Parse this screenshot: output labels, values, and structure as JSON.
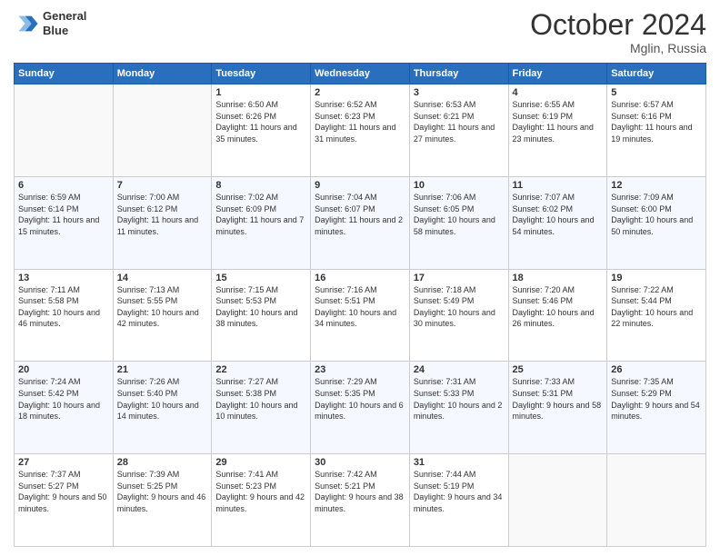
{
  "header": {
    "logo_line1": "General",
    "logo_line2": "Blue",
    "month": "October 2024",
    "location": "Mglin, Russia"
  },
  "days_of_week": [
    "Sunday",
    "Monday",
    "Tuesday",
    "Wednesday",
    "Thursday",
    "Friday",
    "Saturday"
  ],
  "weeks": [
    [
      {
        "day": "",
        "info": ""
      },
      {
        "day": "",
        "info": ""
      },
      {
        "day": "1",
        "sunrise": "Sunrise: 6:50 AM",
        "sunset": "Sunset: 6:26 PM",
        "daylight": "Daylight: 11 hours and 35 minutes."
      },
      {
        "day": "2",
        "sunrise": "Sunrise: 6:52 AM",
        "sunset": "Sunset: 6:23 PM",
        "daylight": "Daylight: 11 hours and 31 minutes."
      },
      {
        "day": "3",
        "sunrise": "Sunrise: 6:53 AM",
        "sunset": "Sunset: 6:21 PM",
        "daylight": "Daylight: 11 hours and 27 minutes."
      },
      {
        "day": "4",
        "sunrise": "Sunrise: 6:55 AM",
        "sunset": "Sunset: 6:19 PM",
        "daylight": "Daylight: 11 hours and 23 minutes."
      },
      {
        "day": "5",
        "sunrise": "Sunrise: 6:57 AM",
        "sunset": "Sunset: 6:16 PM",
        "daylight": "Daylight: 11 hours and 19 minutes."
      }
    ],
    [
      {
        "day": "6",
        "sunrise": "Sunrise: 6:59 AM",
        "sunset": "Sunset: 6:14 PM",
        "daylight": "Daylight: 11 hours and 15 minutes."
      },
      {
        "day": "7",
        "sunrise": "Sunrise: 7:00 AM",
        "sunset": "Sunset: 6:12 PM",
        "daylight": "Daylight: 11 hours and 11 minutes."
      },
      {
        "day": "8",
        "sunrise": "Sunrise: 7:02 AM",
        "sunset": "Sunset: 6:09 PM",
        "daylight": "Daylight: 11 hours and 7 minutes."
      },
      {
        "day": "9",
        "sunrise": "Sunrise: 7:04 AM",
        "sunset": "Sunset: 6:07 PM",
        "daylight": "Daylight: 11 hours and 2 minutes."
      },
      {
        "day": "10",
        "sunrise": "Sunrise: 7:06 AM",
        "sunset": "Sunset: 6:05 PM",
        "daylight": "Daylight: 10 hours and 58 minutes."
      },
      {
        "day": "11",
        "sunrise": "Sunrise: 7:07 AM",
        "sunset": "Sunset: 6:02 PM",
        "daylight": "Daylight: 10 hours and 54 minutes."
      },
      {
        "day": "12",
        "sunrise": "Sunrise: 7:09 AM",
        "sunset": "Sunset: 6:00 PM",
        "daylight": "Daylight: 10 hours and 50 minutes."
      }
    ],
    [
      {
        "day": "13",
        "sunrise": "Sunrise: 7:11 AM",
        "sunset": "Sunset: 5:58 PM",
        "daylight": "Daylight: 10 hours and 46 minutes."
      },
      {
        "day": "14",
        "sunrise": "Sunrise: 7:13 AM",
        "sunset": "Sunset: 5:55 PM",
        "daylight": "Daylight: 10 hours and 42 minutes."
      },
      {
        "day": "15",
        "sunrise": "Sunrise: 7:15 AM",
        "sunset": "Sunset: 5:53 PM",
        "daylight": "Daylight: 10 hours and 38 minutes."
      },
      {
        "day": "16",
        "sunrise": "Sunrise: 7:16 AM",
        "sunset": "Sunset: 5:51 PM",
        "daylight": "Daylight: 10 hours and 34 minutes."
      },
      {
        "day": "17",
        "sunrise": "Sunrise: 7:18 AM",
        "sunset": "Sunset: 5:49 PM",
        "daylight": "Daylight: 10 hours and 30 minutes."
      },
      {
        "day": "18",
        "sunrise": "Sunrise: 7:20 AM",
        "sunset": "Sunset: 5:46 PM",
        "daylight": "Daylight: 10 hours and 26 minutes."
      },
      {
        "day": "19",
        "sunrise": "Sunrise: 7:22 AM",
        "sunset": "Sunset: 5:44 PM",
        "daylight": "Daylight: 10 hours and 22 minutes."
      }
    ],
    [
      {
        "day": "20",
        "sunrise": "Sunrise: 7:24 AM",
        "sunset": "Sunset: 5:42 PM",
        "daylight": "Daylight: 10 hours and 18 minutes."
      },
      {
        "day": "21",
        "sunrise": "Sunrise: 7:26 AM",
        "sunset": "Sunset: 5:40 PM",
        "daylight": "Daylight: 10 hours and 14 minutes."
      },
      {
        "day": "22",
        "sunrise": "Sunrise: 7:27 AM",
        "sunset": "Sunset: 5:38 PM",
        "daylight": "Daylight: 10 hours and 10 minutes."
      },
      {
        "day": "23",
        "sunrise": "Sunrise: 7:29 AM",
        "sunset": "Sunset: 5:35 PM",
        "daylight": "Daylight: 10 hours and 6 minutes."
      },
      {
        "day": "24",
        "sunrise": "Sunrise: 7:31 AM",
        "sunset": "Sunset: 5:33 PM",
        "daylight": "Daylight: 10 hours and 2 minutes."
      },
      {
        "day": "25",
        "sunrise": "Sunrise: 7:33 AM",
        "sunset": "Sunset: 5:31 PM",
        "daylight": "Daylight: 9 hours and 58 minutes."
      },
      {
        "day": "26",
        "sunrise": "Sunrise: 7:35 AM",
        "sunset": "Sunset: 5:29 PM",
        "daylight": "Daylight: 9 hours and 54 minutes."
      }
    ],
    [
      {
        "day": "27",
        "sunrise": "Sunrise: 7:37 AM",
        "sunset": "Sunset: 5:27 PM",
        "daylight": "Daylight: 9 hours and 50 minutes."
      },
      {
        "day": "28",
        "sunrise": "Sunrise: 7:39 AM",
        "sunset": "Sunset: 5:25 PM",
        "daylight": "Daylight: 9 hours and 46 minutes."
      },
      {
        "day": "29",
        "sunrise": "Sunrise: 7:41 AM",
        "sunset": "Sunset: 5:23 PM",
        "daylight": "Daylight: 9 hours and 42 minutes."
      },
      {
        "day": "30",
        "sunrise": "Sunrise: 7:42 AM",
        "sunset": "Sunset: 5:21 PM",
        "daylight": "Daylight: 9 hours and 38 minutes."
      },
      {
        "day": "31",
        "sunrise": "Sunrise: 7:44 AM",
        "sunset": "Sunset: 5:19 PM",
        "daylight": "Daylight: 9 hours and 34 minutes."
      },
      {
        "day": "",
        "info": ""
      },
      {
        "day": "",
        "info": ""
      }
    ]
  ]
}
